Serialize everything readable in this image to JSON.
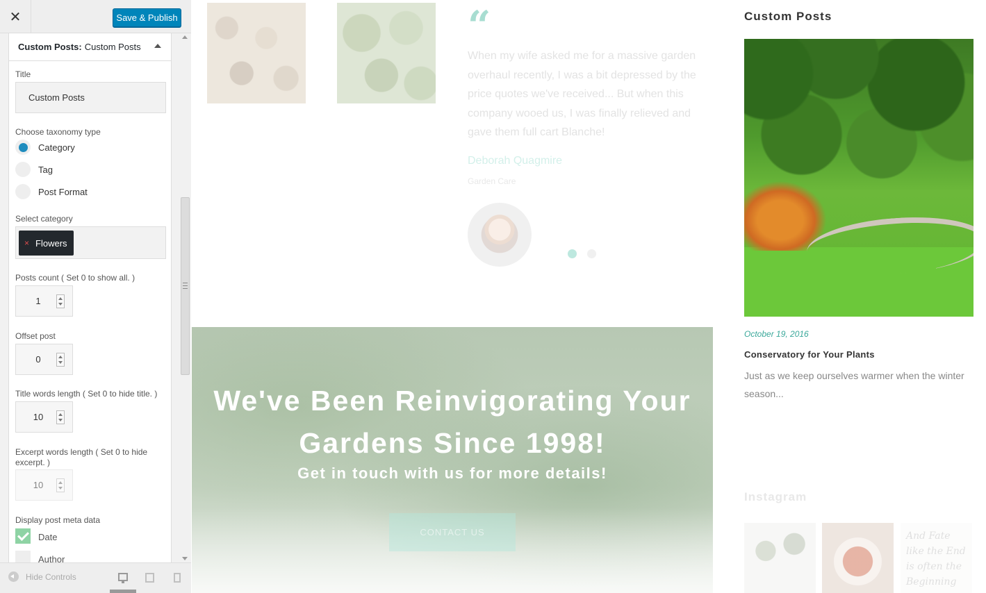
{
  "topbar": {
    "close_label": "✕",
    "publish_label": "Save & Publish"
  },
  "widget": {
    "head_type": "Custom Posts:",
    "head_name": "Custom Posts",
    "title_label": "Title",
    "title_value": "Custom Posts",
    "taxonomy_label": "Choose taxonomy type",
    "taxonomy_options": [
      {
        "label": "Category",
        "selected": true
      },
      {
        "label": "Tag",
        "selected": false
      },
      {
        "label": "Post Format",
        "selected": false
      }
    ],
    "category_label": "Select category",
    "category_tag": "Flowers",
    "category_remove": "×",
    "posts_count_label": "Posts count ( Set 0 to show all. )",
    "posts_count": "1",
    "offset_label": "Offset post",
    "offset": "0",
    "title_words_label": "Title words length ( Set 0 to hide title. )",
    "title_words": "10",
    "excerpt_words_label": "Excerpt words length ( Set 0 to hide excerpt. )",
    "excerpt_words": "10",
    "meta_label": "Display post meta data",
    "meta_options": [
      {
        "label": "Date",
        "checked": true
      },
      {
        "label": "Author",
        "checked": false
      }
    ]
  },
  "footer": {
    "hide_controls": "Hide Controls"
  },
  "preview": {
    "quote_mark": "“",
    "testimonial": "When my wife asked me for a massive garden overhaul recently, I was a bit depressed by the price quotes we've received... But when this company wooed us, I was finally relieved and gave them full cart Blanche!",
    "testimonial_author": "Deborah Quagmire",
    "testimonial_role": "Garden Care",
    "hero_title": "We've Been Reinvigorating Your Gardens Since 1998!",
    "hero_subtitle": "Get in touch with us for more details!",
    "hero_button": "CONTACT US",
    "widget_title": "Custom Posts",
    "post_date": "October 19, 2016",
    "post_title": "Conservatory for Your Plants",
    "post_excerpt": "Just as we keep ourselves warmer when the winter season...",
    "instagram_title": "Instagram",
    "instagram_handwriting": "And Fate like the End is often the Beginning"
  },
  "colors": {
    "publish_button": "#0085ba",
    "accent_teal": "#3aa89a",
    "category_tag_bg": "#23282d"
  }
}
